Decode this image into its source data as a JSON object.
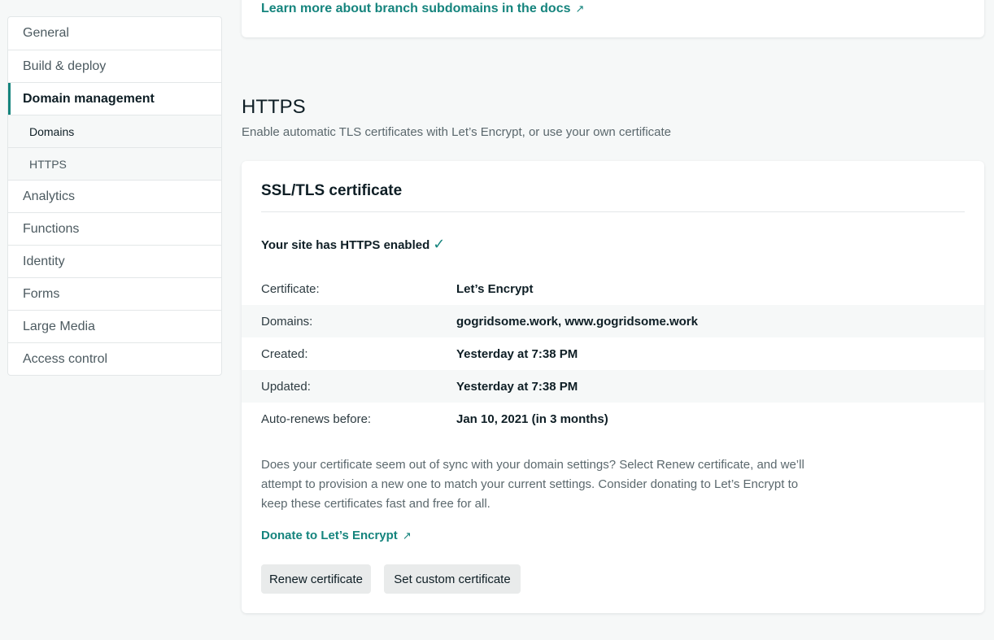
{
  "sidebar": {
    "items": [
      {
        "label": "General"
      },
      {
        "label": "Build & deploy"
      },
      {
        "label": "Domain management"
      },
      {
        "label": "Domains"
      },
      {
        "label": "HTTPS"
      },
      {
        "label": "Analytics"
      },
      {
        "label": "Functions"
      },
      {
        "label": "Identity"
      },
      {
        "label": "Forms"
      },
      {
        "label": "Large Media"
      },
      {
        "label": "Access control"
      }
    ]
  },
  "branch_card": {
    "doc_link": "Learn more about branch subdomains in the docs",
    "external_icon": "arrow-up-right-icon"
  },
  "https_section": {
    "title": "HTTPS",
    "description": "Enable automatic TLS certificates with Let’s Encrypt, or use your own certificate"
  },
  "cert_card": {
    "title": "SSL/TLS certificate",
    "status": "Your site has HTTPS enabled",
    "status_icon": "checkmark-icon",
    "rows": [
      {
        "label": "Certificate:",
        "value": "Let’s Encrypt"
      },
      {
        "label": "Domains:",
        "value": "gogridsome.work, www.gogridsome.work"
      },
      {
        "label": "Created:",
        "value": "Yesterday at 7:38 PM"
      },
      {
        "label": "Updated:",
        "value": "Yesterday at 7:38 PM"
      },
      {
        "label": "Auto-renews before:",
        "value": "Jan 10, 2021 (in 3 months)"
      }
    ],
    "note": "Does your certificate seem out of sync with your domain settings? Select Renew certificate, and we’ll attempt to provision a new one to match your current settings. Consider donating to Let’s Encrypt to keep these certificates fast and free for all.",
    "donate_link": "Donate to Let’s Encrypt",
    "renew_button": "Renew certificate",
    "custom_button": "Set custom certificate"
  },
  "colors": {
    "accent": "#15847d",
    "background": "#f6f8f8",
    "button_bg": "#e9ebeb"
  }
}
